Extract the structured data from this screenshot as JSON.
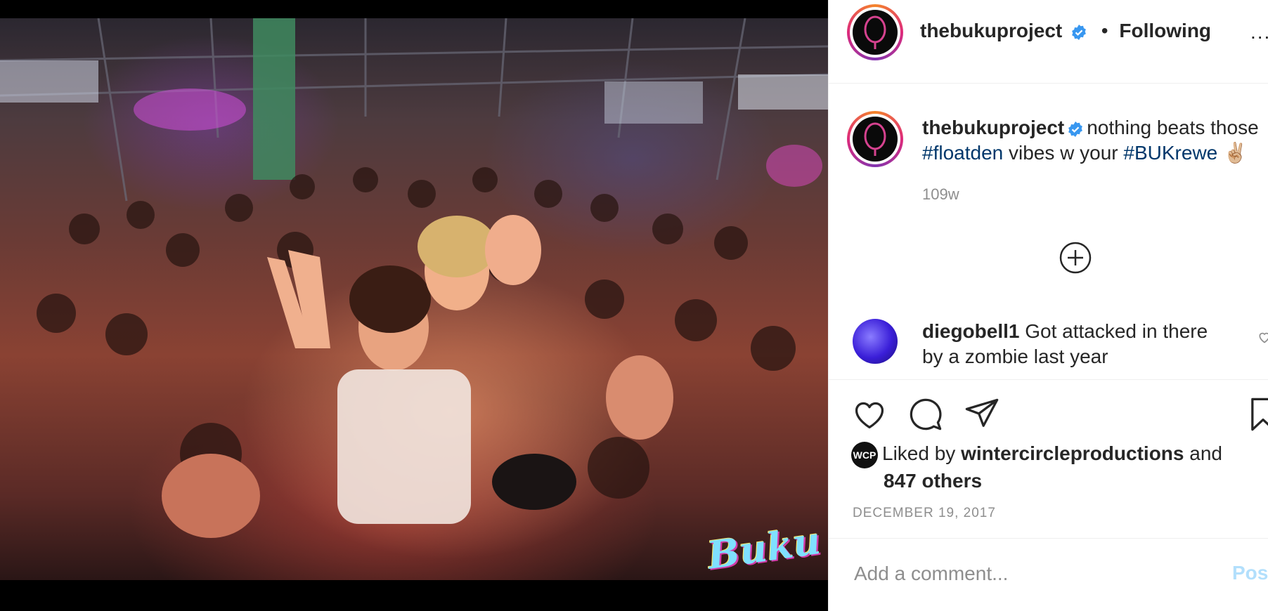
{
  "post": {
    "username": "thebukuproject",
    "follow_status": "Following",
    "separator": "•",
    "more_label": "..."
  },
  "photo": {
    "watermark": "Buku"
  },
  "caption": {
    "username": "thebukuproject",
    "text_part1": "nothing beats those",
    "hashtag1": "#floatden",
    "text_part2": "vibes w your",
    "hashtag2": "#BUKrewe",
    "emoji": "✌🏼",
    "time": "109w"
  },
  "comment": {
    "username": "diegobell1",
    "text_line1": "Got attacked in there",
    "text_line2": "by a zombie last year"
  },
  "likes": {
    "avatar_label": "WCP",
    "prefix": "Liked by",
    "liker": "wintercircleproductions",
    "conjunction": "and",
    "others": "847 others"
  },
  "date": "DECEMBER 19, 2017",
  "composer": {
    "placeholder": "Add a comment...",
    "post_label": "Post"
  },
  "colors": {
    "hashtag": "#00376b",
    "verified": "#3897f0",
    "muted": "#8e8e8e",
    "post_disabled": "#b2dffc"
  }
}
